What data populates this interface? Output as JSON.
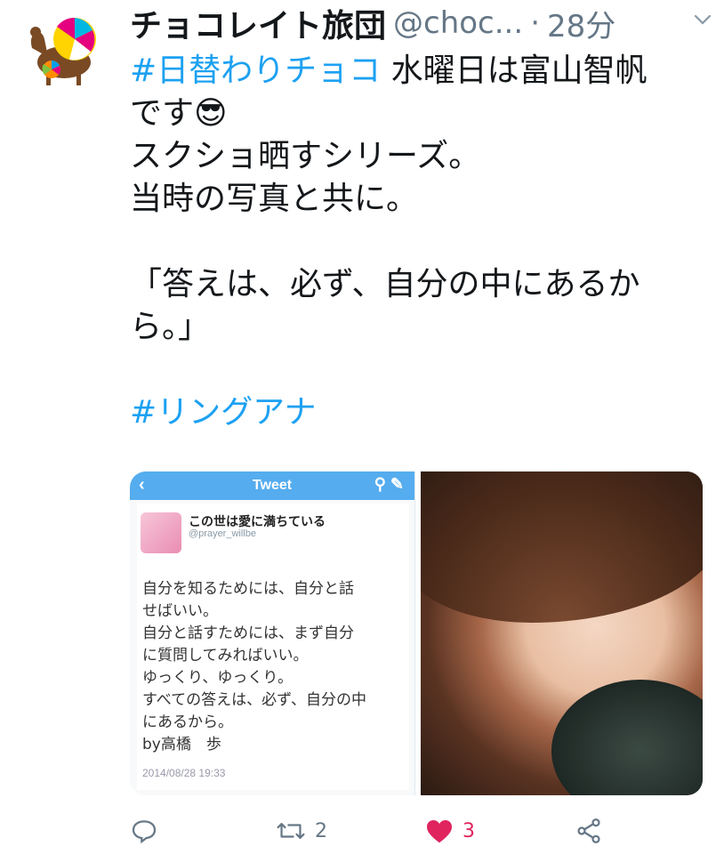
{
  "tweet": {
    "display_name": "チョコレイト旅団",
    "handle": "@choc...",
    "separator": "·",
    "timestamp": "28分",
    "hashtag1": "#日替わりチョコ",
    "line1_rest": " 水曜日は富山智帆",
    "line2": "です",
    "line2_emoji": "😎",
    "line3": "スクショ晒すシリーズ。",
    "line4": "当時の写真と共に。",
    "quote_line1": "「答えは、必ず、自分の中にあるか",
    "quote_line2": "ら。」",
    "hashtag2": "#リングアナ"
  },
  "embedded_screenshot": {
    "bar_title": "Tweet",
    "user_name": "この世は愛に満ちている",
    "user_handle": "@prayer_willbe",
    "lines": [
      "自分を知るためには、自分と話",
      "せばいい。",
      "自分と話すためには、まず自分",
      "に質問してみればいい。",
      "ゆっくり、ゆっくり。",
      "すべての答えは、必ず、自分の中",
      "にあるから。",
      "by高橋　歩"
    ],
    "date": "2014/08/28 19:33"
  },
  "actions": {
    "reply_icon": "reply-icon",
    "retweet_icon": "retweet-icon",
    "retweet_count": "2",
    "like_icon": "heart-icon",
    "like_count": "3",
    "like_color": "#e0245e",
    "share_icon": "share-icon"
  },
  "colors": {
    "link": "#1da1f2",
    "muted": "#657786"
  }
}
